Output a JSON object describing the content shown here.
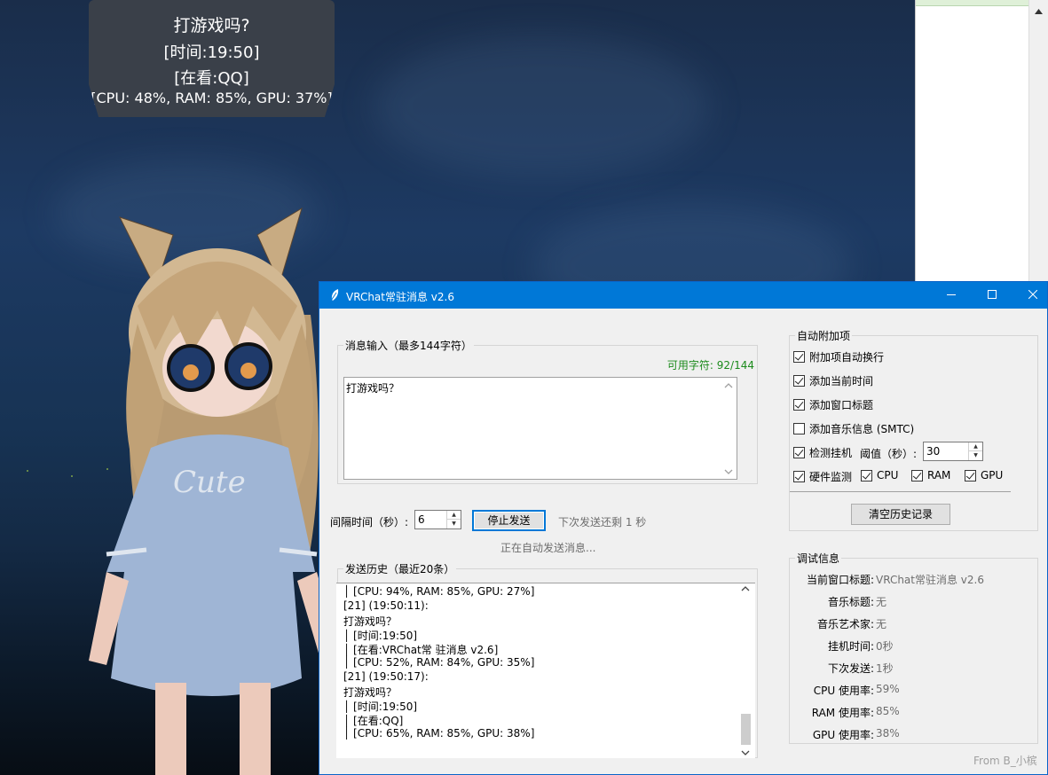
{
  "overlay": {
    "message": "打游戏吗?",
    "time_line": "[时间:19:50]",
    "watching_line": "[在看:QQ]",
    "hardware_line": "[CPU: 48%, RAM: 85%, GPU: 37%]"
  },
  "window": {
    "title": "VRChat常驻消息 v2.6",
    "icon": "feather-icon",
    "accent_color": "#0078d7"
  },
  "message_input": {
    "group_label": "消息输入（最多144字符）",
    "available_chars": "可用字符: 92/144",
    "value": "打游戏吗？"
  },
  "send_controls": {
    "interval_label": "间隔时间（秒）:",
    "interval_value": "6",
    "stop_button": "停止发送",
    "countdown": "下次发送还剩 1 秒",
    "status": "正在自动发送消息..."
  },
  "history": {
    "group_label": "发送历史（最近20条）",
    "lines": [
      "│ [CPU: 94%, RAM: 85%, GPU: 27%]",
      "[21] (19:50:11):",
      "打游戏吗？",
      "│ [时间:19:50]",
      "│ [在看:VRChat常 驻消息 v2.6]",
      "│ [CPU: 52%, RAM: 84%, GPU: 35%]",
      "[21] (19:50:17):",
      "打游戏吗？",
      "│ [时间:19:50]",
      "│ [在看:QQ]",
      "│ [CPU: 65%, RAM: 85%, GPU: 38%]"
    ]
  },
  "auto_items": {
    "group_label": "自动附加项",
    "auto_wrap": {
      "label": "附加项自动换行",
      "checked": true
    },
    "add_time": {
      "label": "添加当前时间",
      "checked": true
    },
    "add_window_title": {
      "label": "添加窗口标题",
      "checked": true
    },
    "add_music": {
      "label": "添加音乐信息 (SMTC)",
      "checked": false
    },
    "detect_afk": {
      "label": "检测挂机",
      "checked": true
    },
    "threshold_label": "阈值（秒）:",
    "threshold_value": "30",
    "hardware_monitor": {
      "label": "硬件监测",
      "checked": true
    },
    "cpu": {
      "label": "CPU",
      "checked": true
    },
    "ram": {
      "label": "RAM",
      "checked": true
    },
    "gpu": {
      "label": "GPU",
      "checked": true
    },
    "clear_history_button": "清空历史记录"
  },
  "debug": {
    "group_label": "调试信息",
    "rows": [
      {
        "key": "当前窗口标题:",
        "value": "VRChat常驻消息 v2.6"
      },
      {
        "key": "音乐标题:",
        "value": "无"
      },
      {
        "key": "音乐艺术家:",
        "value": "无"
      },
      {
        "key": "挂机时间:",
        "value": "0秒"
      },
      {
        "key": "下次发送:",
        "value": "1秒"
      },
      {
        "key": "CPU 使用率:",
        "value": "59%"
      },
      {
        "key": "RAM 使用率:",
        "value": "85%"
      },
      {
        "key": "GPU 使用率:",
        "value": "38%"
      }
    ]
  },
  "footer_credit": "From B_小槟"
}
